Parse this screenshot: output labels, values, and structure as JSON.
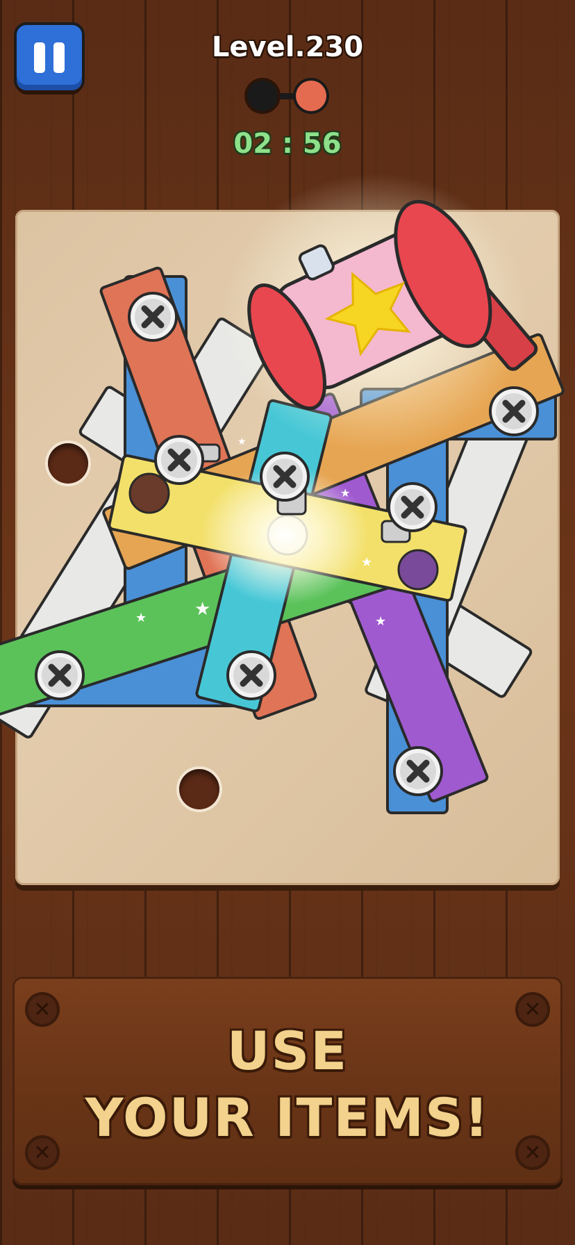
{
  "hud": {
    "level_label": "Level.230",
    "timer": "02 : 56",
    "stage_progress": {
      "total": 2,
      "current": 2
    },
    "pause_icon": "pause-icon"
  },
  "board": {
    "hole_count": 4,
    "colors": {
      "blue": "#4a90d6",
      "red": "#e07456",
      "orange": "#e6a552",
      "yellow": "#f3e06a",
      "green": "#5bc25a",
      "cyan": "#47c7d6",
      "purple": "#a05ad0",
      "white": "#e8e8e6"
    }
  },
  "powerup": {
    "name": "hammer",
    "icon": "hammer-icon",
    "accent": "#e8474f"
  },
  "banner": {
    "line1": "USE",
    "line2": "YOUR ITEMS!"
  }
}
